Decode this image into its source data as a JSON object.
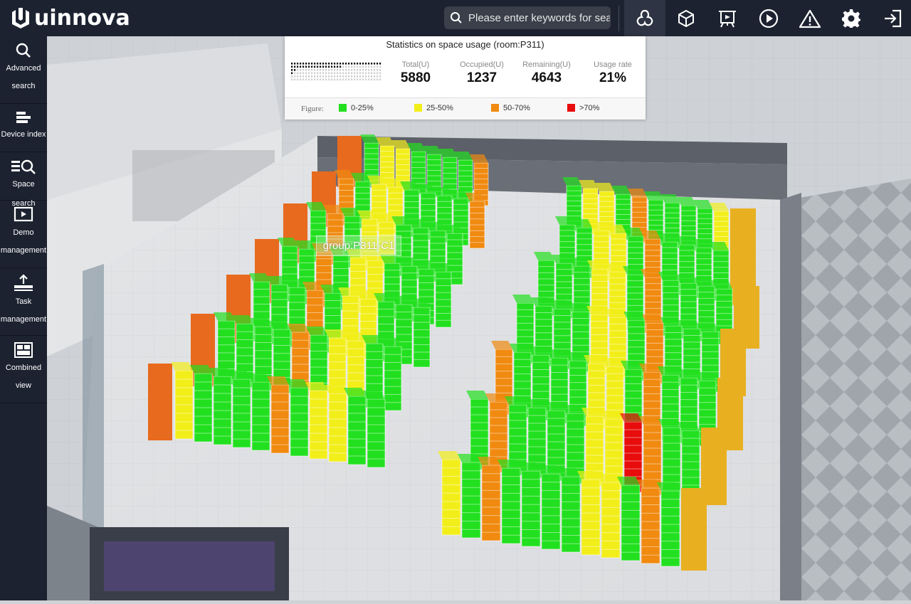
{
  "app": {
    "brand": "uinnova"
  },
  "search": {
    "placeholder": "Please enter keywords for search"
  },
  "toolbar": {
    "buttons": [
      {
        "icon": "cluster-icon",
        "active": true
      },
      {
        "icon": "cube-icon",
        "active": false
      },
      {
        "icon": "presentation-icon",
        "active": false
      },
      {
        "icon": "play-icon",
        "active": false
      },
      {
        "icon": "warning-icon",
        "active": false
      },
      {
        "icon": "gear-icon",
        "active": false
      },
      {
        "icon": "logout-icon",
        "active": false
      }
    ]
  },
  "sidebar": {
    "items": [
      {
        "icon": "search-icon",
        "line1": "Advanced",
        "line2": "search"
      },
      {
        "icon": "index-icon",
        "line1": "Device index"
      },
      {
        "icon": "space-search-icon",
        "line1": "Space search"
      },
      {
        "icon": "demo-icon",
        "line1": "Demo",
        "line2": "management"
      },
      {
        "icon": "task-icon",
        "line1": "Task",
        "line2": "management"
      },
      {
        "icon": "combined-view-icon",
        "line1": "Combined",
        "line2": "view"
      }
    ]
  },
  "stats": {
    "title": "Statistics on space usage (room:P311)",
    "metrics": [
      {
        "label": "Total(U)",
        "value": "5880"
      },
      {
        "label": "Occupied(U)",
        "value": "1237"
      },
      {
        "label": "Remaining(U)",
        "value": "4643"
      },
      {
        "label": "Usage rate",
        "value": "21%"
      }
    ],
    "legend_title": "Figure:",
    "legend": [
      {
        "label": "0-25%",
        "color": "#22e01f"
      },
      {
        "label": "25-50%",
        "color": "#f2ee1a"
      },
      {
        "label": "50-70%",
        "color": "#f08a10"
      },
      {
        "label": ">70%",
        "color": "#e80c0c"
      }
    ]
  },
  "scene": {
    "group_label": "group:P311-C1"
  },
  "colors": {
    "bar": "#1c2230",
    "green": "#22e01f",
    "yellow": "#f2ee1a",
    "orange": "#f08a10",
    "red": "#e80c0c",
    "cabinet_orange": "#e86a1e",
    "cabinet_gold": "#e8b020"
  }
}
